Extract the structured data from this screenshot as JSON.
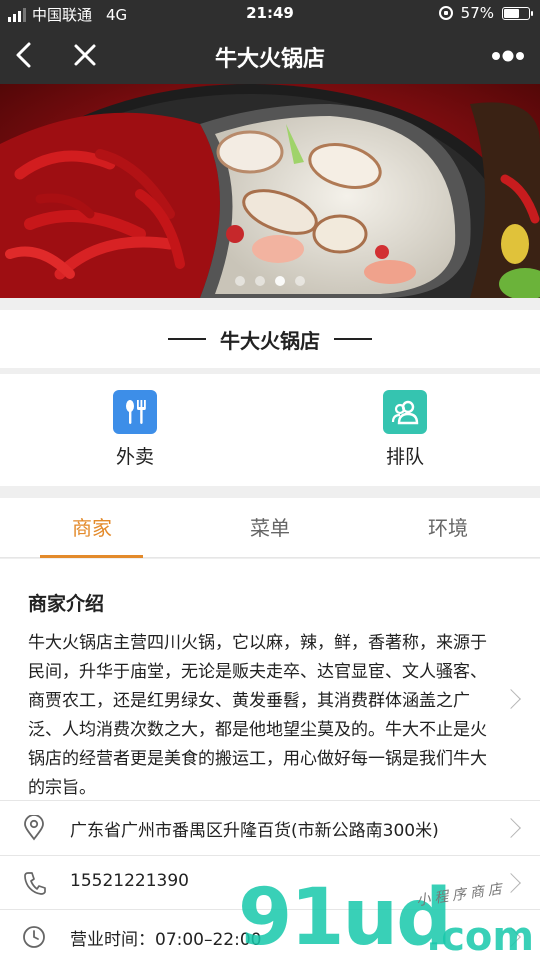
{
  "status_bar": {
    "carrier": "中国联通",
    "network": "4G",
    "time": "21:49",
    "battery": "57%"
  },
  "nav": {
    "title": "牛大火锅店"
  },
  "banner": {
    "slide_count": 4,
    "active_slide": 2
  },
  "store": {
    "name": "牛大火锅店"
  },
  "services": [
    {
      "label": "外卖",
      "icon": "fork-spoon-icon",
      "color": "#3d8ee8"
    },
    {
      "label": "排队",
      "icon": "people-icon",
      "color": "#35c4b0"
    }
  ],
  "tabs": [
    {
      "label": "商家",
      "active": true
    },
    {
      "label": "菜单",
      "active": false
    },
    {
      "label": "环境",
      "active": false
    }
  ],
  "intro": {
    "title": "商家介绍",
    "text": "牛大火锅店主营四川火锅，它以麻，辣，鲜，香著称，来源于民间，升华于庙堂，无论是贩夫走卒、达官显宦、文人骚客、商贾农工，还是红男绿女、黄发垂髫，其消费群体涵盖之广泛、人均消费次数之大，都是他地望尘莫及的。牛大不止是火锅店的经营者更是美食的搬运工，用心做好每一锅是我们牛大的宗旨。"
  },
  "info": {
    "address": "广东省广州市番禺区升隆百货(市新公路南300米)",
    "phone": "15521221390",
    "hours": "营业时间：07:00–22:00"
  },
  "watermark": {
    "logo": "91ud",
    "domain": ".com",
    "tagline": "小程序商店"
  },
  "colors": {
    "accent": "#e38a2b",
    "nav_bg": "#2f2f2f"
  }
}
